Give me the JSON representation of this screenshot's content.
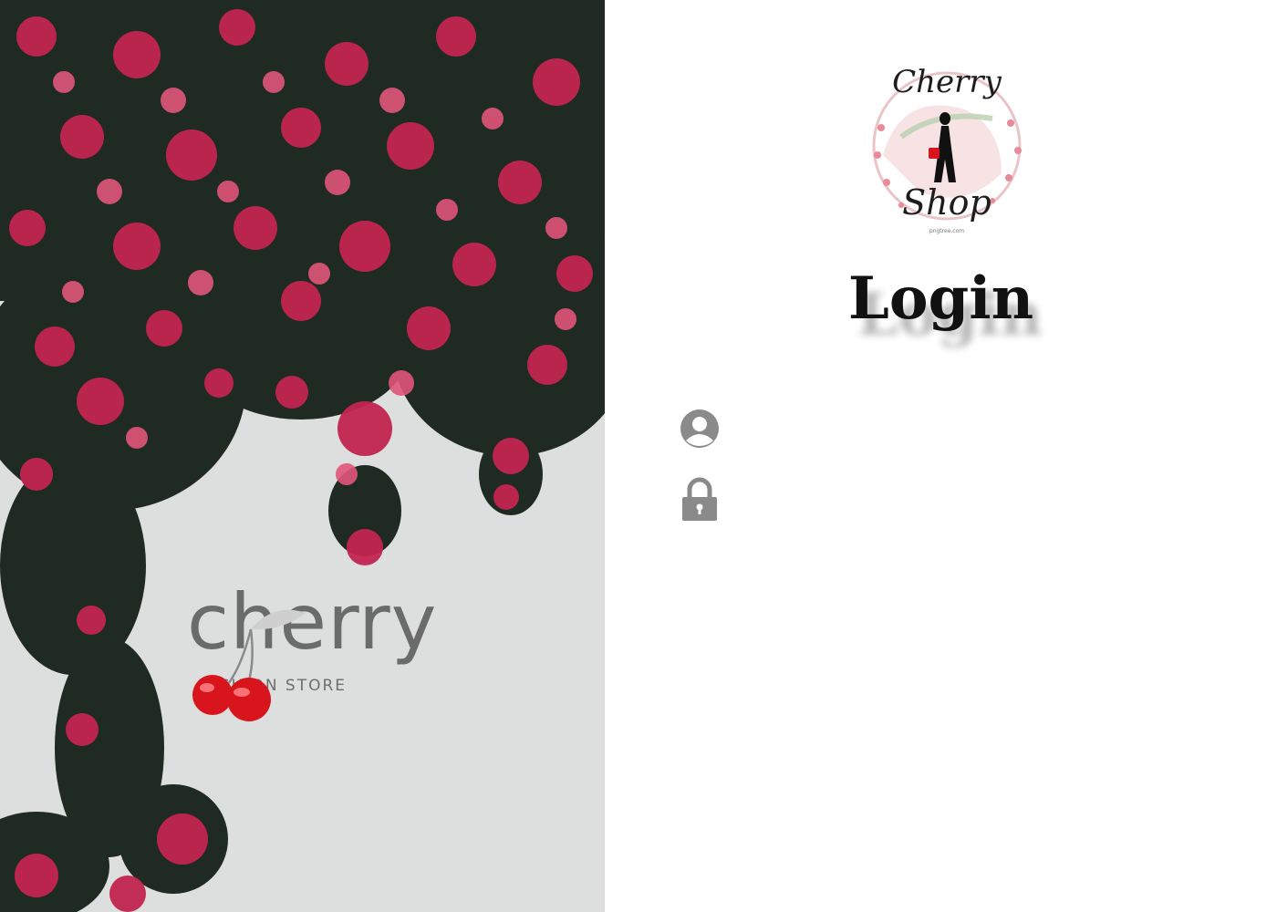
{
  "hero": {
    "brand_word": "cherry",
    "brand_tagline": "FASHION STORE"
  },
  "login": {
    "logo_top": "Cherry",
    "logo_bottom": "Shop",
    "logo_credit": "pngtree.com",
    "title": "Login",
    "username": {
      "value": "",
      "placeholder": ""
    },
    "password": {
      "value": "",
      "placeholder": ""
    }
  },
  "icons": {
    "user": "user-circle-icon",
    "lock": "lock-icon"
  },
  "colors": {
    "flower_pink": "#c2254f",
    "leaf_dark": "#1f2a22",
    "cherry_red": "#d8141c",
    "icon_gray": "#8a8a8a"
  }
}
